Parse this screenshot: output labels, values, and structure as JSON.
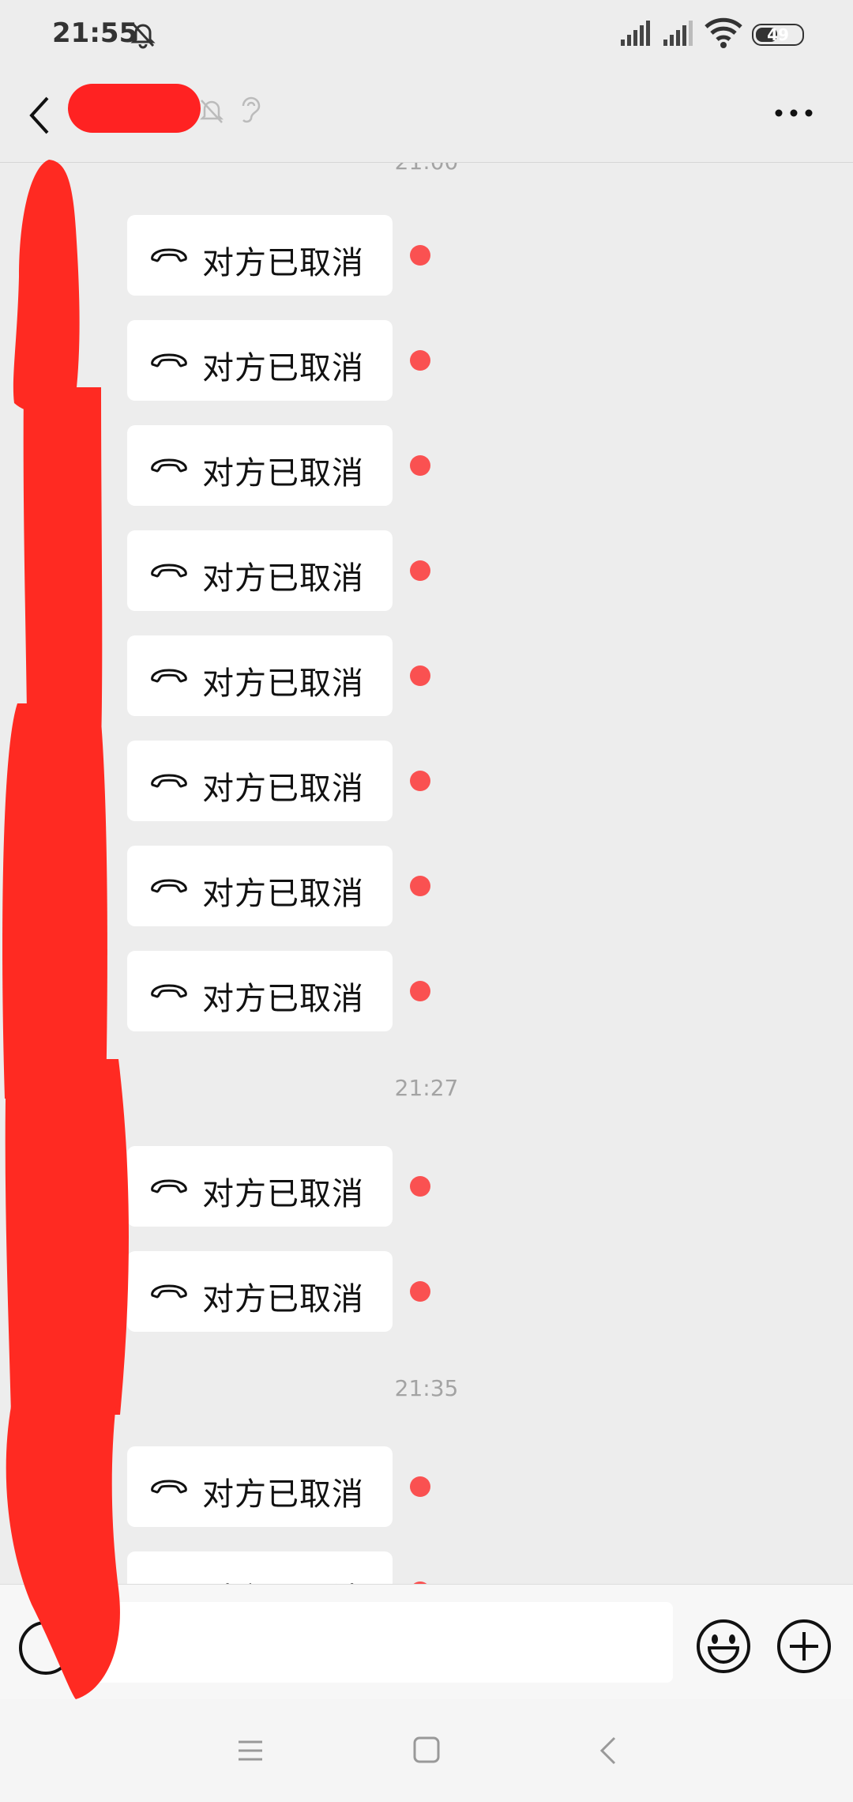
{
  "status_bar": {
    "time": "21:55",
    "battery": "49",
    "battery_level": 0.49
  },
  "header": {
    "contact_name": "",
    "more_label": "···"
  },
  "chat": {
    "timestamps": [
      "21:00",
      "21:27",
      "21:35"
    ],
    "messages": [
      {
        "text": "对方已取消",
        "status": "unread"
      },
      {
        "text": "对方已取消",
        "status": "unread"
      },
      {
        "text": "对方已取消",
        "status": "unread"
      },
      {
        "text": "对方已取消",
        "status": "unread"
      },
      {
        "text": "对方已取消",
        "status": "unread"
      },
      {
        "text": "对方已取消",
        "status": "unread"
      },
      {
        "text": "对方已取消",
        "status": "unread"
      },
      {
        "text": "对方已取消",
        "status": "unread"
      },
      {
        "text": "对方已取消",
        "status": "unread"
      },
      {
        "text": "对方已取消",
        "status": "unread"
      },
      {
        "text": "对方已取消",
        "status": "unread"
      },
      {
        "text": "对方已取消",
        "status": "unread"
      }
    ]
  },
  "input_bar": {
    "placeholder": ""
  },
  "colors": {
    "unread_dot": "#fa5151",
    "redaction": "#ff2a22",
    "background": "#ededed"
  },
  "icons": [
    "back-arrow-icon",
    "mute-bell-icon",
    "earpiece-icon",
    "more-icon",
    "hangup-phone-icon",
    "voice-icon",
    "emoji-icon",
    "plus-icon",
    "menu-icon",
    "home-icon",
    "nav-back-icon"
  ]
}
